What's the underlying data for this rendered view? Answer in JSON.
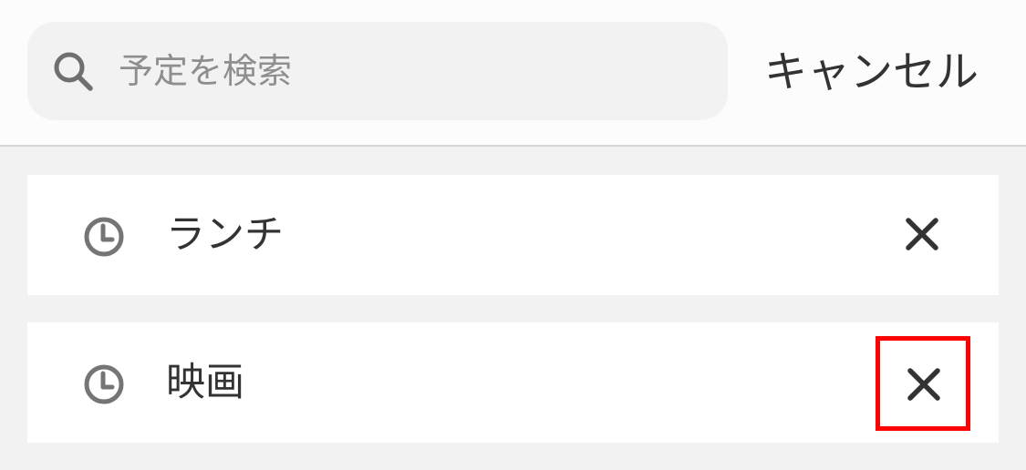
{
  "search": {
    "placeholder": "予定を検索",
    "value": "",
    "icon": "search-icon"
  },
  "header": {
    "cancel_label": "キャンセル"
  },
  "history": {
    "items": [
      {
        "label": "ランチ",
        "icon": "clock-icon",
        "remove_icon": "close-icon",
        "highlighted": false
      },
      {
        "label": "映画",
        "icon": "clock-icon",
        "remove_icon": "close-icon",
        "highlighted": true
      }
    ]
  },
  "colors": {
    "background": "#f2f2f2",
    "header_background": "#fcfcfc",
    "text": "#333333",
    "icon": "#757575",
    "placeholder": "#8e8e8e",
    "highlight": "#ff0000"
  }
}
